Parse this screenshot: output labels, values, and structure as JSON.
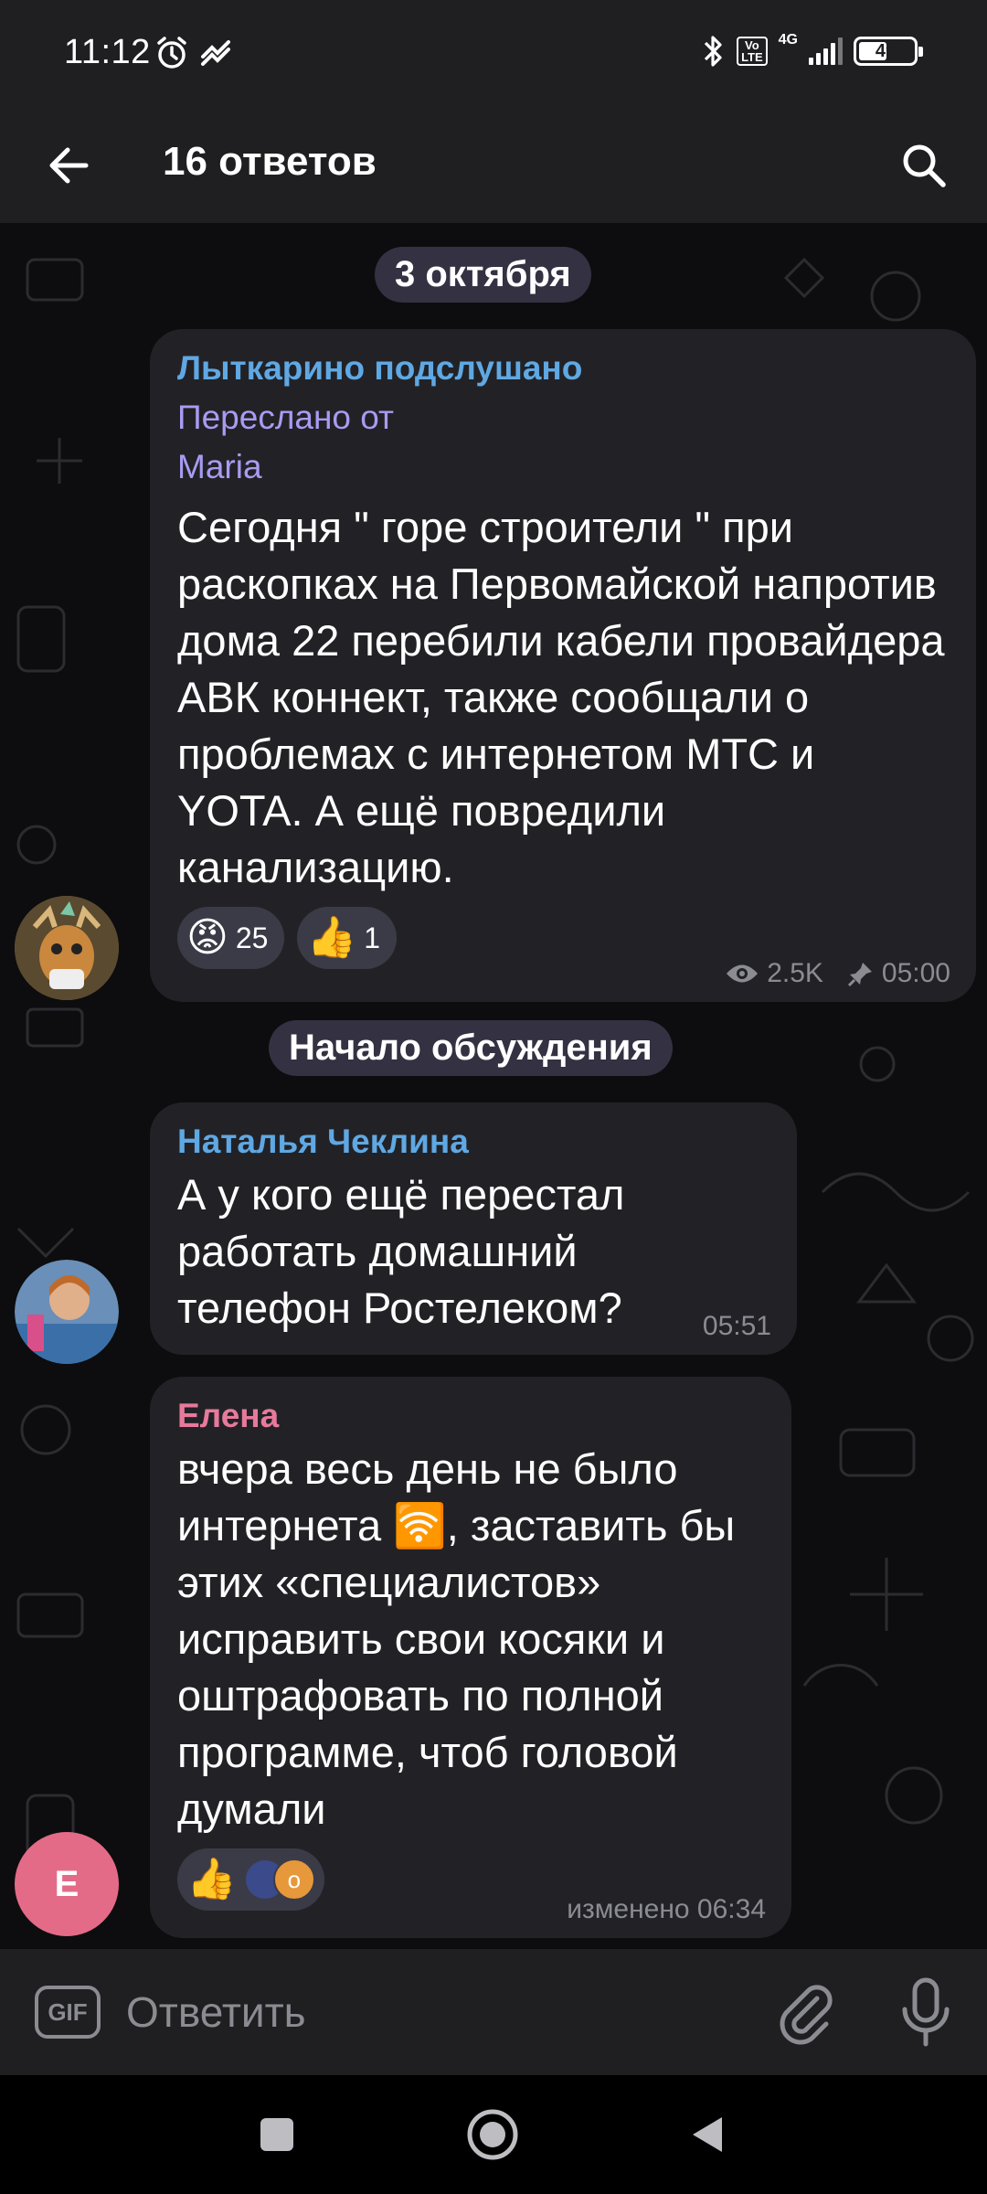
{
  "status_bar": {
    "time": "11:12",
    "volte": "Vo LTE",
    "network": "4G",
    "battery": "49"
  },
  "header": {
    "title": "16 ответов",
    "back_icon": "arrow-left-icon",
    "search_icon": "search-icon"
  },
  "chat": {
    "date_pill": "3 октября",
    "post": {
      "sender": "Лыткарино подслушано",
      "forwarded_label": "Переслано от",
      "forwarded_from": "Maria",
      "text": "Сегодня \" горе  строители \"  при раскопках на Первомайской напротив дома 22 перебили кабели провайдера АВК коннект, также сообщали о проблемах с интернетом МТС и YOTA. А ещё повредили канализацию.",
      "reactions": [
        {
          "emoji": "😡",
          "count": "25"
        },
        {
          "emoji": "👍",
          "count": "1"
        }
      ],
      "views": "2.5K",
      "time": "05:00"
    },
    "discussion_pill": "Начало обсуждения",
    "comments": [
      {
        "sender": "Наталья Чеклина",
        "sender_color": "#5fa8e3",
        "text": "А у кого ещё перестал работать домашний телефон Ростелеком?",
        "time": "05:51"
      },
      {
        "sender": "Елена",
        "sender_color": "#e77a9c",
        "avatar_letter": "Е",
        "text_before": "вчера весь день не было интернета ",
        "text_emoji": "🛜",
        "text_after": ", заставить бы этих «специалистов» исправить свои косяки и оштрафовать по полной программе, чтоб головой думали",
        "reaction_emoji": "👍",
        "reaction_avatar_letter": "о",
        "time": "изменено 06:34"
      }
    ]
  },
  "input": {
    "gif_label": "GIF",
    "placeholder": "Ответить"
  },
  "colors": {
    "header_bg": "#1f1f21",
    "bubble_bg": "#222226",
    "channel_name": "#5fa8e3",
    "forwarded": "#a99bf2",
    "elena_avatar": "#e46b87"
  }
}
